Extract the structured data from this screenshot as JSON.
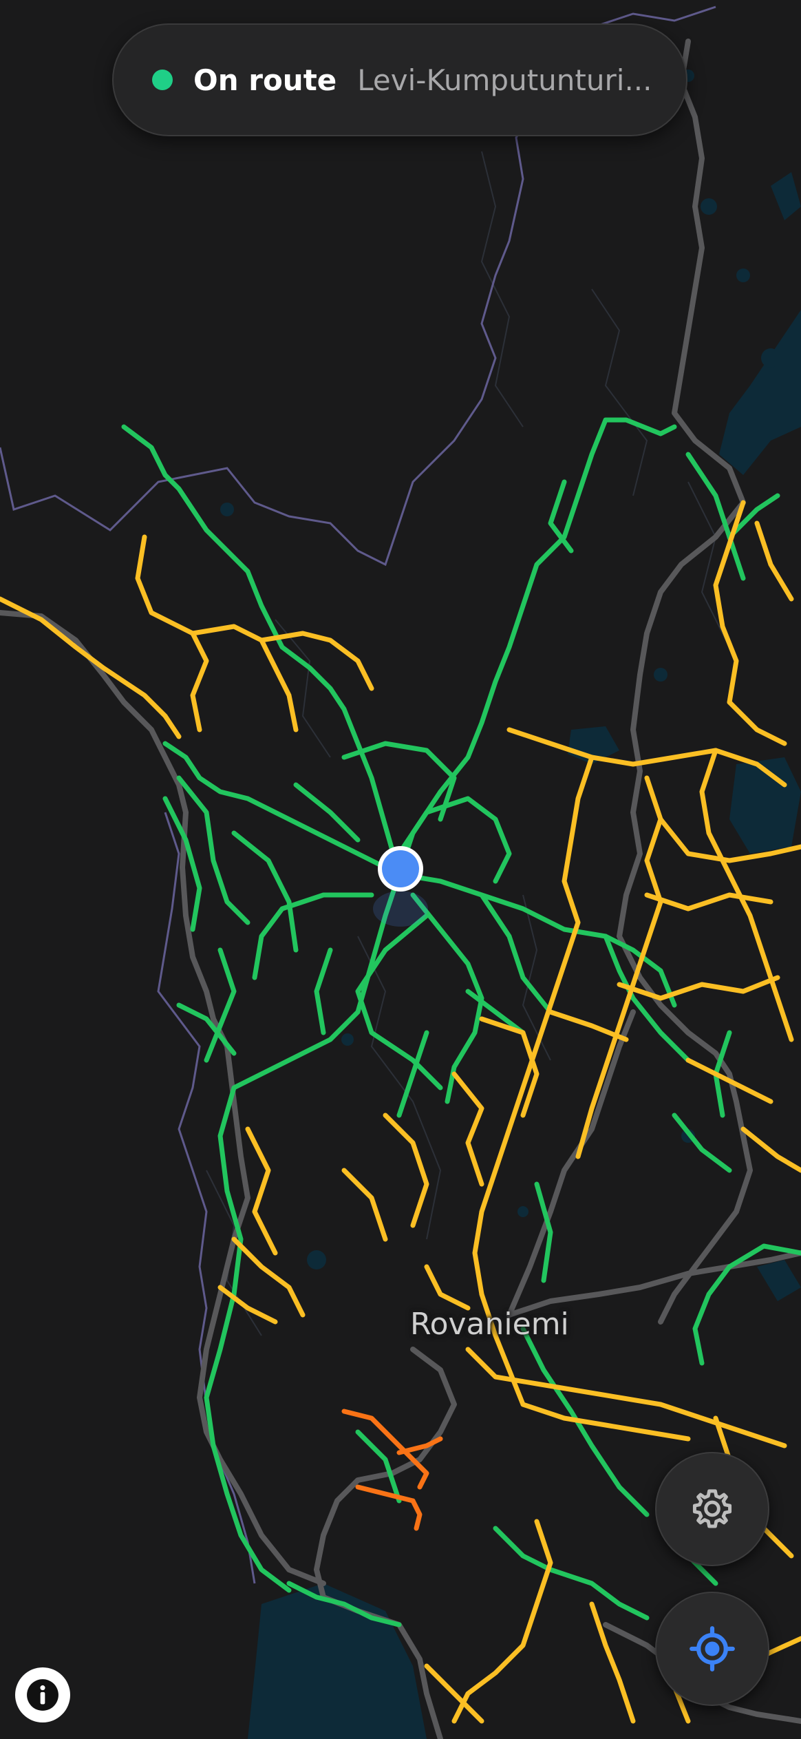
{
  "status": {
    "label": "On route",
    "route_name": "Levi-Kumputunturi...",
    "dot_color": "#1fcf87"
  },
  "map": {
    "place_label": "Rovaniemi",
    "legend_colors": {
      "green_trail": "#22c55e",
      "yellow_trail": "#fbbf24",
      "orange_trail": "#f97316",
      "road": "#58585a",
      "border": "#5f5a8c",
      "water": "#0d2a38"
    },
    "location_marker_color": "#4b8cf5"
  },
  "controls": {
    "settings_icon": "gear-icon",
    "locate_icon": "crosshair-icon",
    "info_icon": "info-icon",
    "accent": "#3b82f6"
  }
}
